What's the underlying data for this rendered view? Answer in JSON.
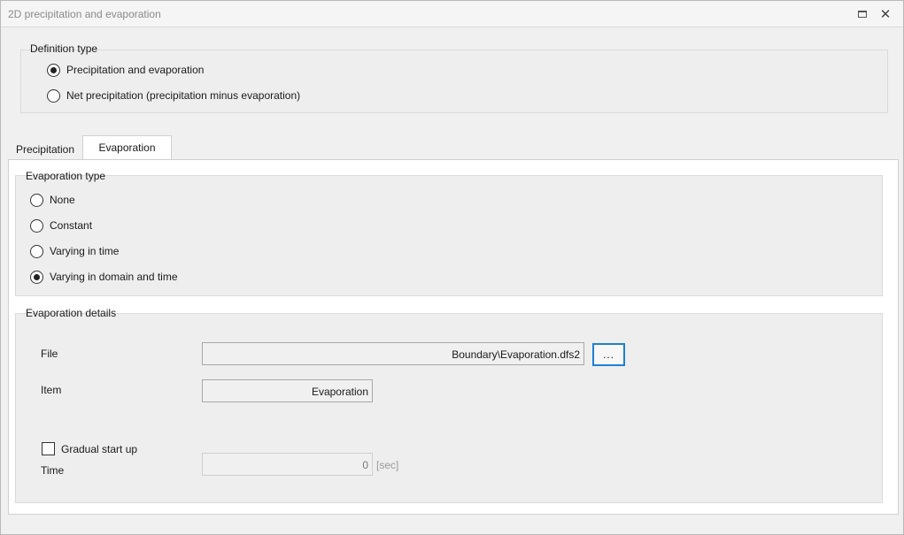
{
  "window": {
    "title": "2D precipitation and evaporation",
    "close_glyph": "✕"
  },
  "definition_type": {
    "legend": "Definition type",
    "options": [
      {
        "label": "Precipitation and evaporation",
        "checked": true
      },
      {
        "label": "Net precipitation (precipitation minus evaporation)",
        "checked": false
      }
    ]
  },
  "tabs": [
    {
      "label": "Precipitation",
      "active": false
    },
    {
      "label": "Evaporation",
      "active": true
    }
  ],
  "evaporation_type": {
    "legend": "Evaporation type",
    "options": [
      {
        "label": "None",
        "checked": false
      },
      {
        "label": "Constant",
        "checked": false
      },
      {
        "label": "Varying in time",
        "checked": false
      },
      {
        "label": "Varying in domain and time",
        "checked": true
      }
    ]
  },
  "evaporation_details": {
    "legend": "Evaporation details",
    "file_label": "File",
    "file_value": "Boundary\\Evaporation.dfs2",
    "browse_label": "...",
    "item_label": "Item",
    "item_value": "Evaporation",
    "gradual_start_label": "Gradual start up",
    "gradual_start_checked": false,
    "time_label": "Time",
    "time_value": "0",
    "time_unit": "[sec]"
  },
  "icons": {
    "maximize": "maximize-icon",
    "close": "close-icon"
  }
}
